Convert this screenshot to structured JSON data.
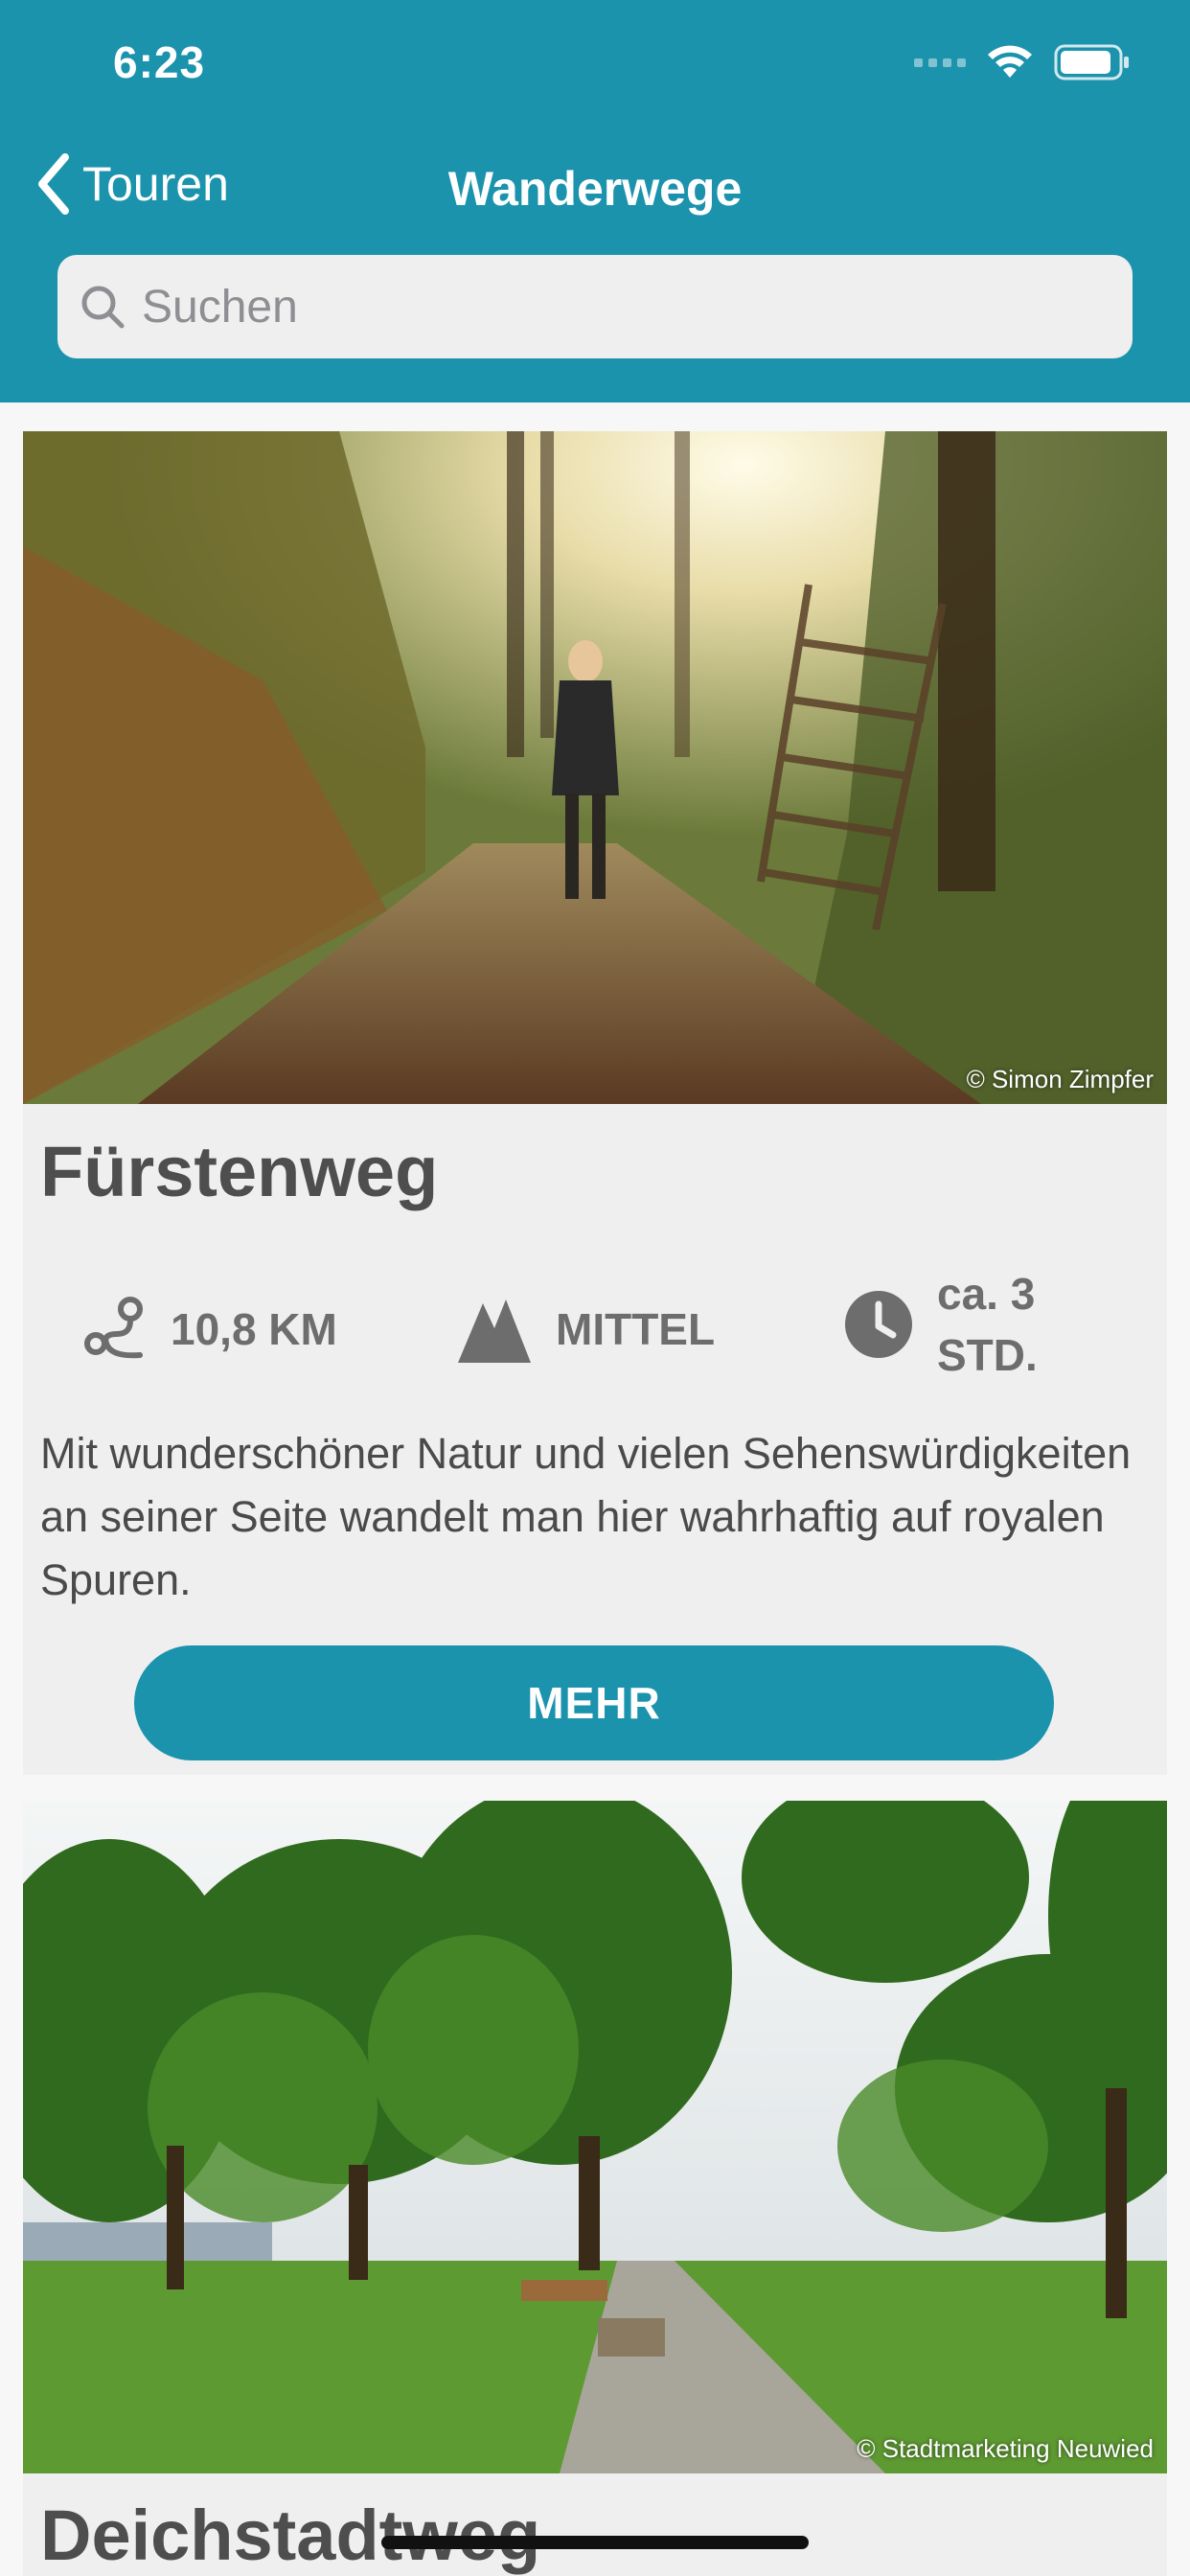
{
  "status_bar": {
    "time": "6:23"
  },
  "nav": {
    "back_label": "Touren",
    "title": "Wanderwege"
  },
  "search": {
    "placeholder": "Suchen",
    "value": ""
  },
  "colors": {
    "primary": "#1b93ac",
    "card_bg": "#efefef",
    "text": "#4e4e4e"
  },
  "routes": [
    {
      "title": "Fürstenweg",
      "photo_credit": "© Simon Zimpfer",
      "distance": "10,8 KM",
      "difficulty": "MITTEL",
      "duration": "ca. 3 STD.",
      "duration_line1": "ca. 3",
      "duration_line2": "STD.",
      "description": "Mit wunderschöner Natur und vielen Sehenswürdigkeiten an seiner Seite wandelt man hier wahrhaftig auf royalen Spuren.",
      "button_label": "MEHR"
    },
    {
      "title": "Deichstadtweg",
      "photo_credit": "© Stadtmarketing Neuwied"
    }
  ]
}
